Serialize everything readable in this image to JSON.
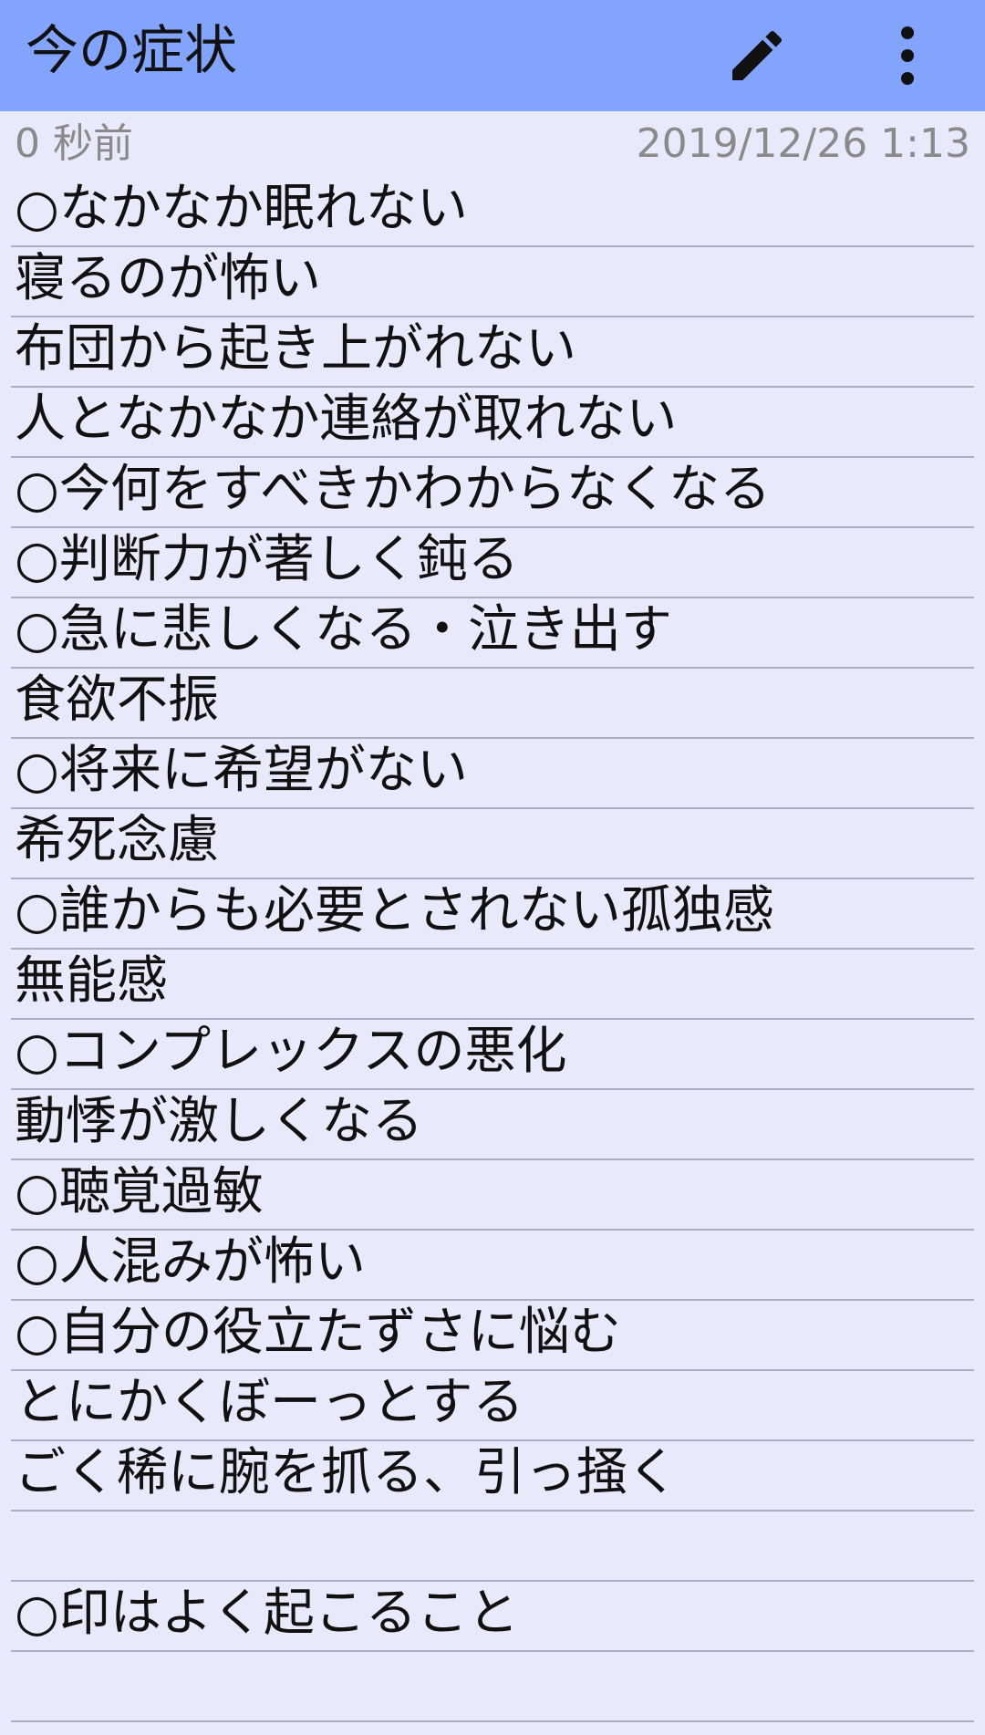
{
  "app_bar": {
    "title": "今の症状",
    "edit_icon": "pencil-icon",
    "more_icon": "more-vertical-icon",
    "background": "#82a4fc"
  },
  "meta": {
    "relative_time": "0 秒前",
    "datetime": "2019/12/26 1:13"
  },
  "note": {
    "lines": [
      "○なかなか眠れない",
      "寝るのが怖い",
      "布団から起き上がれない",
      "人となかなか連絡が取れない",
      "○今何をすべきかわからなくなる",
      "○判断力が著しく鈍る",
      "○急に悲しくなる・泣き出す",
      "食欲不振",
      "○将来に希望がない",
      "希死念慮",
      "○誰からも必要とされない孤独感",
      "無能感",
      "○コンプレックスの悪化",
      "動悸が激しくなる",
      "○聴覚過敏",
      "○人混みが怖い",
      "○自分の役立たずさに悩む",
      "とにかくぼーっとする",
      "ごく稀に腕を抓る、引っ掻く",
      "",
      "○印はよく起こること",
      ""
    ]
  }
}
